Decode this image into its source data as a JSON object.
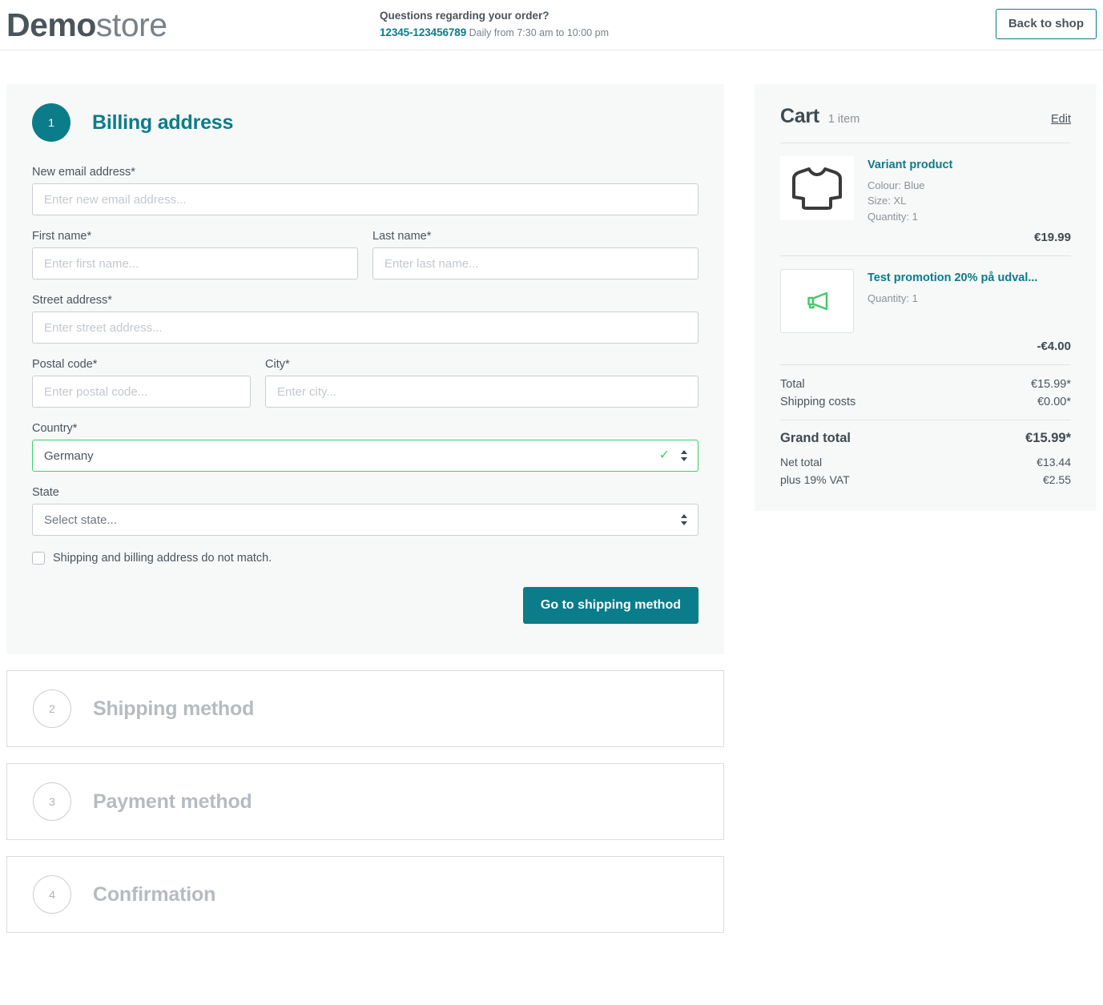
{
  "header": {
    "logo_bold": "Demo",
    "logo_light": "store",
    "contact_title": "Questions regarding your order?",
    "contact_phone": "12345-123456789",
    "contact_hours": "Daily from 7:30 am to 10:00 pm",
    "back_to_shop_label": "Back to shop"
  },
  "colors": {
    "accent_teal": "#0b7c8a",
    "valid_green": "#3ecf6b",
    "panel_bg": "#f7f8f8",
    "text": "#4a545b",
    "muted": "#8b9298",
    "disabled": "#b6bbc0"
  },
  "steps": [
    {
      "number": "1",
      "title": "Billing address",
      "state": "active"
    },
    {
      "number": "2",
      "title": "Shipping method",
      "state": "collapsed"
    },
    {
      "number": "3",
      "title": "Payment method",
      "state": "collapsed"
    },
    {
      "number": "4",
      "title": "Confirmation",
      "state": "collapsed"
    }
  ],
  "billing_form": {
    "email": {
      "label": "New email address*",
      "placeholder": "Enter new email address...",
      "value": ""
    },
    "first_name": {
      "label": "First name*",
      "placeholder": "Enter first name...",
      "value": ""
    },
    "last_name": {
      "label": "Last name*",
      "placeholder": "Enter last name...",
      "value": ""
    },
    "street": {
      "label": "Street address*",
      "placeholder": "Enter street address...",
      "value": ""
    },
    "postal_code": {
      "label": "Postal code*",
      "placeholder": "Enter postal code...",
      "value": ""
    },
    "city": {
      "label": "City*",
      "placeholder": "Enter city...",
      "value": ""
    },
    "country": {
      "label": "Country*",
      "value": "Germany",
      "valid": true
    },
    "state": {
      "label": "State",
      "value": "Select state...",
      "valid": false
    },
    "shipping_differs": {
      "label": "Shipping and billing address do not match.",
      "checked": false
    },
    "submit_label": "Go to shipping method"
  },
  "cart": {
    "title": "Cart",
    "count_label": "1 item",
    "edit_label": "Edit",
    "items": [
      {
        "name": "Variant product",
        "icon": "sweater-icon",
        "meta": [
          "Colour: Blue",
          "Size: XL",
          "Quantity: 1"
        ],
        "price": "€19.99"
      },
      {
        "name": "Test promotion 20% på udval...",
        "icon": "megaphone-icon",
        "meta": [
          "Quantity: 1"
        ],
        "price": "-€4.00"
      }
    ],
    "totals": [
      {
        "label": "Total",
        "value": "€15.99*"
      },
      {
        "label": "Shipping costs",
        "value": "€0.00*"
      }
    ],
    "grand_total": {
      "label": "Grand total",
      "value": "€15.99*"
    },
    "after_totals": [
      {
        "label": "Net total",
        "value": "€13.44"
      },
      {
        "label": "plus 19% VAT",
        "value": "€2.55"
      }
    ]
  }
}
